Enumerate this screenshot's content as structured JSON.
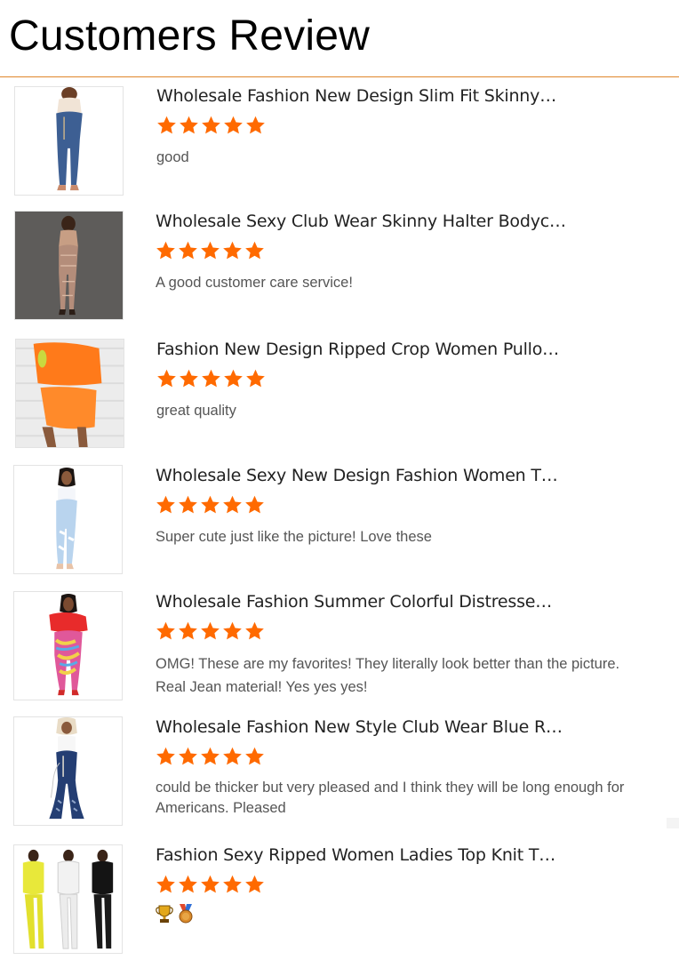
{
  "page": {
    "title": "Customers Review",
    "accent_color": "#e0862a",
    "star_color": "#ff6a00"
  },
  "reviews": [
    {
      "product_title": "Wholesale Fashion New Design Slim Fit Skinny…",
      "rating": 5,
      "text": "good",
      "thumbnail": "woman-blue-jeans-image"
    },
    {
      "product_title": "Wholesale Sexy Club Wear Skinny Halter Bodyc…",
      "rating": 5,
      "text": "A good customer care service!",
      "thumbnail": "woman-sequin-jumpsuit-image"
    },
    {
      "product_title": "Fashion New Design Ripped Crop Women Pullo…",
      "rating": 5,
      "text": "great quality",
      "thumbnail": "woman-orange-knit-set-image"
    },
    {
      "product_title": "Wholesale Sexy New Design Fashion Women T…",
      "rating": 5,
      "text": "Super cute just like the picture! Love these",
      "thumbnail": "woman-ripped-light-jeans-image"
    },
    {
      "product_title": "Wholesale Fashion Summer Colorful Distresse…",
      "rating": 5,
      "text": "OMG! These are my favorites! They literally look better than the picture. Real Jean material! Yes yes yes!",
      "thumbnail": "woman-tie-dye-jeans-image"
    },
    {
      "product_title": "Wholesale Fashion New Style Club Wear Blue R…",
      "rating": 5,
      "text": "could be thicker but very pleased and I think they will be long enough for Americans. Pleased",
      "thumbnail": "woman-flared-blue-jeans-image"
    },
    {
      "product_title": "Fashion Sexy Ripped Women Ladies Top Knit T…",
      "rating": 5,
      "text": "",
      "emojis": [
        "trophy-icon",
        "medal-icon"
      ],
      "thumbnail": "three-women-knit-sets-image"
    }
  ]
}
